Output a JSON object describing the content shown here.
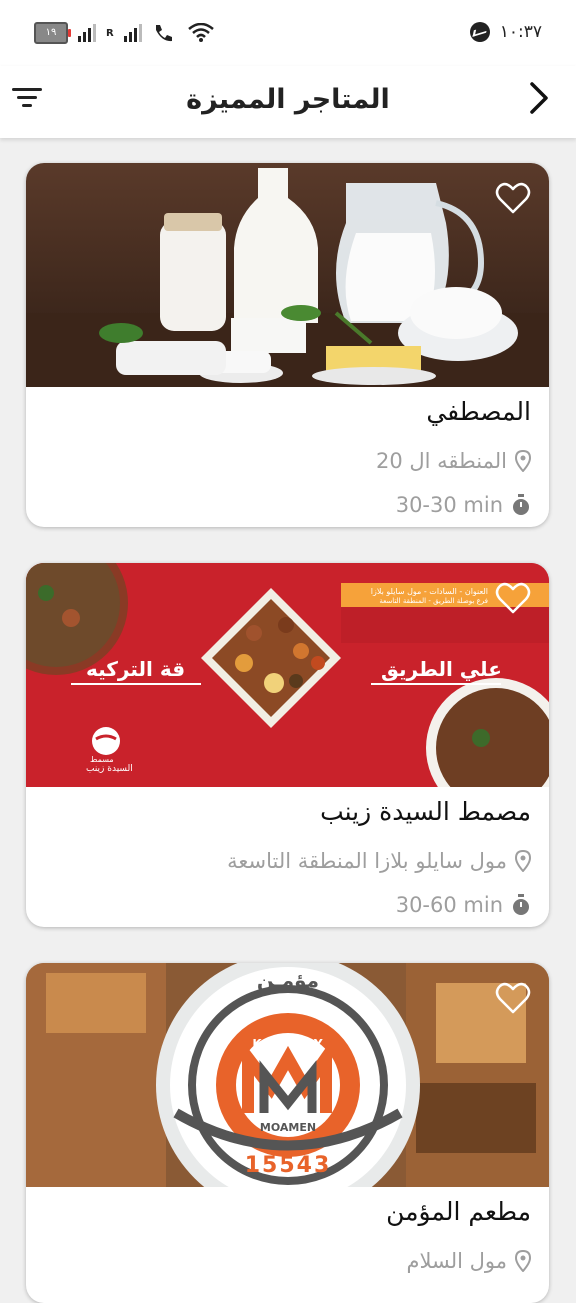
{
  "status_bar": {
    "time": "١٠:٣٧",
    "battery": "١٩"
  },
  "header": {
    "title": "المتاجر المميزة"
  },
  "stores": [
    {
      "name": "المصطفي",
      "location": "المنطقه ال 20",
      "delivery_time": "30-30 min",
      "image": "dairy-products-photo"
    },
    {
      "name": "مصمط السيدة زينب",
      "location": "مول سايلو بلازا المنطقة التاسعة",
      "delivery_time": "30-60 min",
      "image": "food-banner",
      "banner": {
        "headline": "علي الطريق",
        "headline2": "قة التركيه",
        "logo_line1": "مسمط",
        "logo_line2": "السيدة زينب",
        "address": "العنوان - السادات - مول سايلو بلازا",
        "address2": "فرع بوصلة الطريق - المنطقة التاسعة"
      }
    },
    {
      "name": "مطعم المؤمن",
      "location": "مول السلام",
      "delivery_time": "",
      "image": "koshary-logo",
      "logo": {
        "arabic": "مؤمـن",
        "top": "KOSHARY",
        "bottom": "MOAMEN",
        "number": "15543"
      }
    }
  ]
}
